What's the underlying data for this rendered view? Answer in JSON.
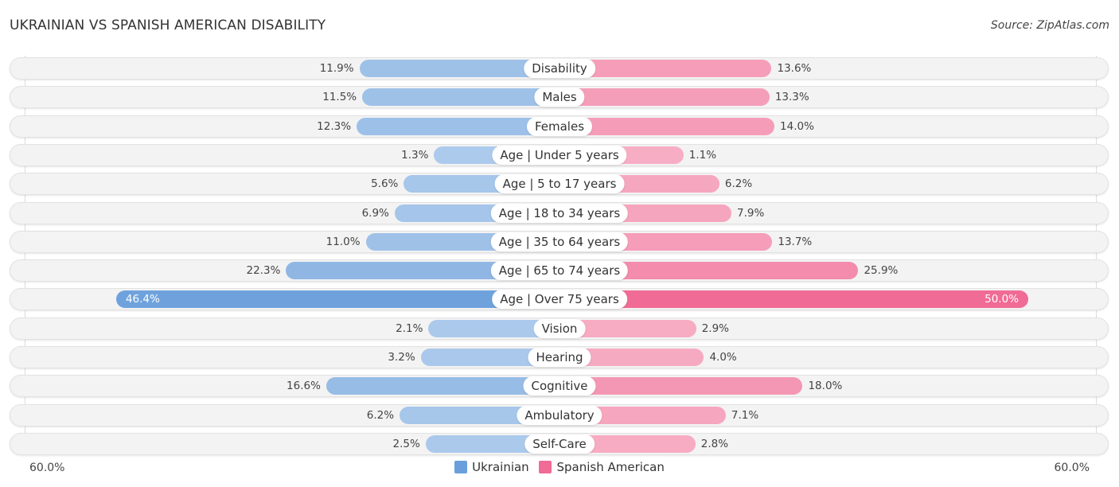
{
  "header": {
    "title": "UKRAINIAN VS SPANISH AMERICAN DISABILITY",
    "source": "Source: ZipAtlas.com"
  },
  "chart_data": {
    "type": "bar",
    "orientation": "horizontal-diverging",
    "title": "UKRAINIAN VS SPANISH AMERICAN DISABILITY",
    "source": "Source: ZipAtlas.com",
    "categories": [
      "Disability",
      "Males",
      "Females",
      "Age | Under 5 years",
      "Age | 5 to 17 years",
      "Age | 18 to 34 years",
      "Age | 35 to 64 years",
      "Age | 65 to 74 years",
      "Age | Over 75 years",
      "Vision",
      "Hearing",
      "Cognitive",
      "Ambulatory",
      "Self-Care"
    ],
    "series": [
      {
        "name": "Ukrainian",
        "color": "#6a9fdb",
        "values": [
          11.9,
          11.5,
          12.3,
          1.3,
          5.6,
          6.9,
          11.0,
          22.3,
          46.4,
          2.1,
          3.2,
          16.6,
          6.2,
          2.5
        ]
      },
      {
        "name": "Spanish American",
        "color": "#f06b95",
        "values": [
          13.6,
          13.3,
          14.0,
          1.1,
          6.2,
          7.9,
          13.7,
          25.9,
          50.0,
          2.9,
          4.0,
          18.0,
          7.1,
          2.8
        ]
      }
    ],
    "value_format": "{v}%",
    "axis": {
      "left_label": "60.0%",
      "right_label": "60.0%",
      "range": [
        0,
        60
      ]
    },
    "legend": {
      "position": "bottom-center",
      "items": [
        "Ukrainian",
        "Spanish American"
      ]
    },
    "grid": false
  }
}
